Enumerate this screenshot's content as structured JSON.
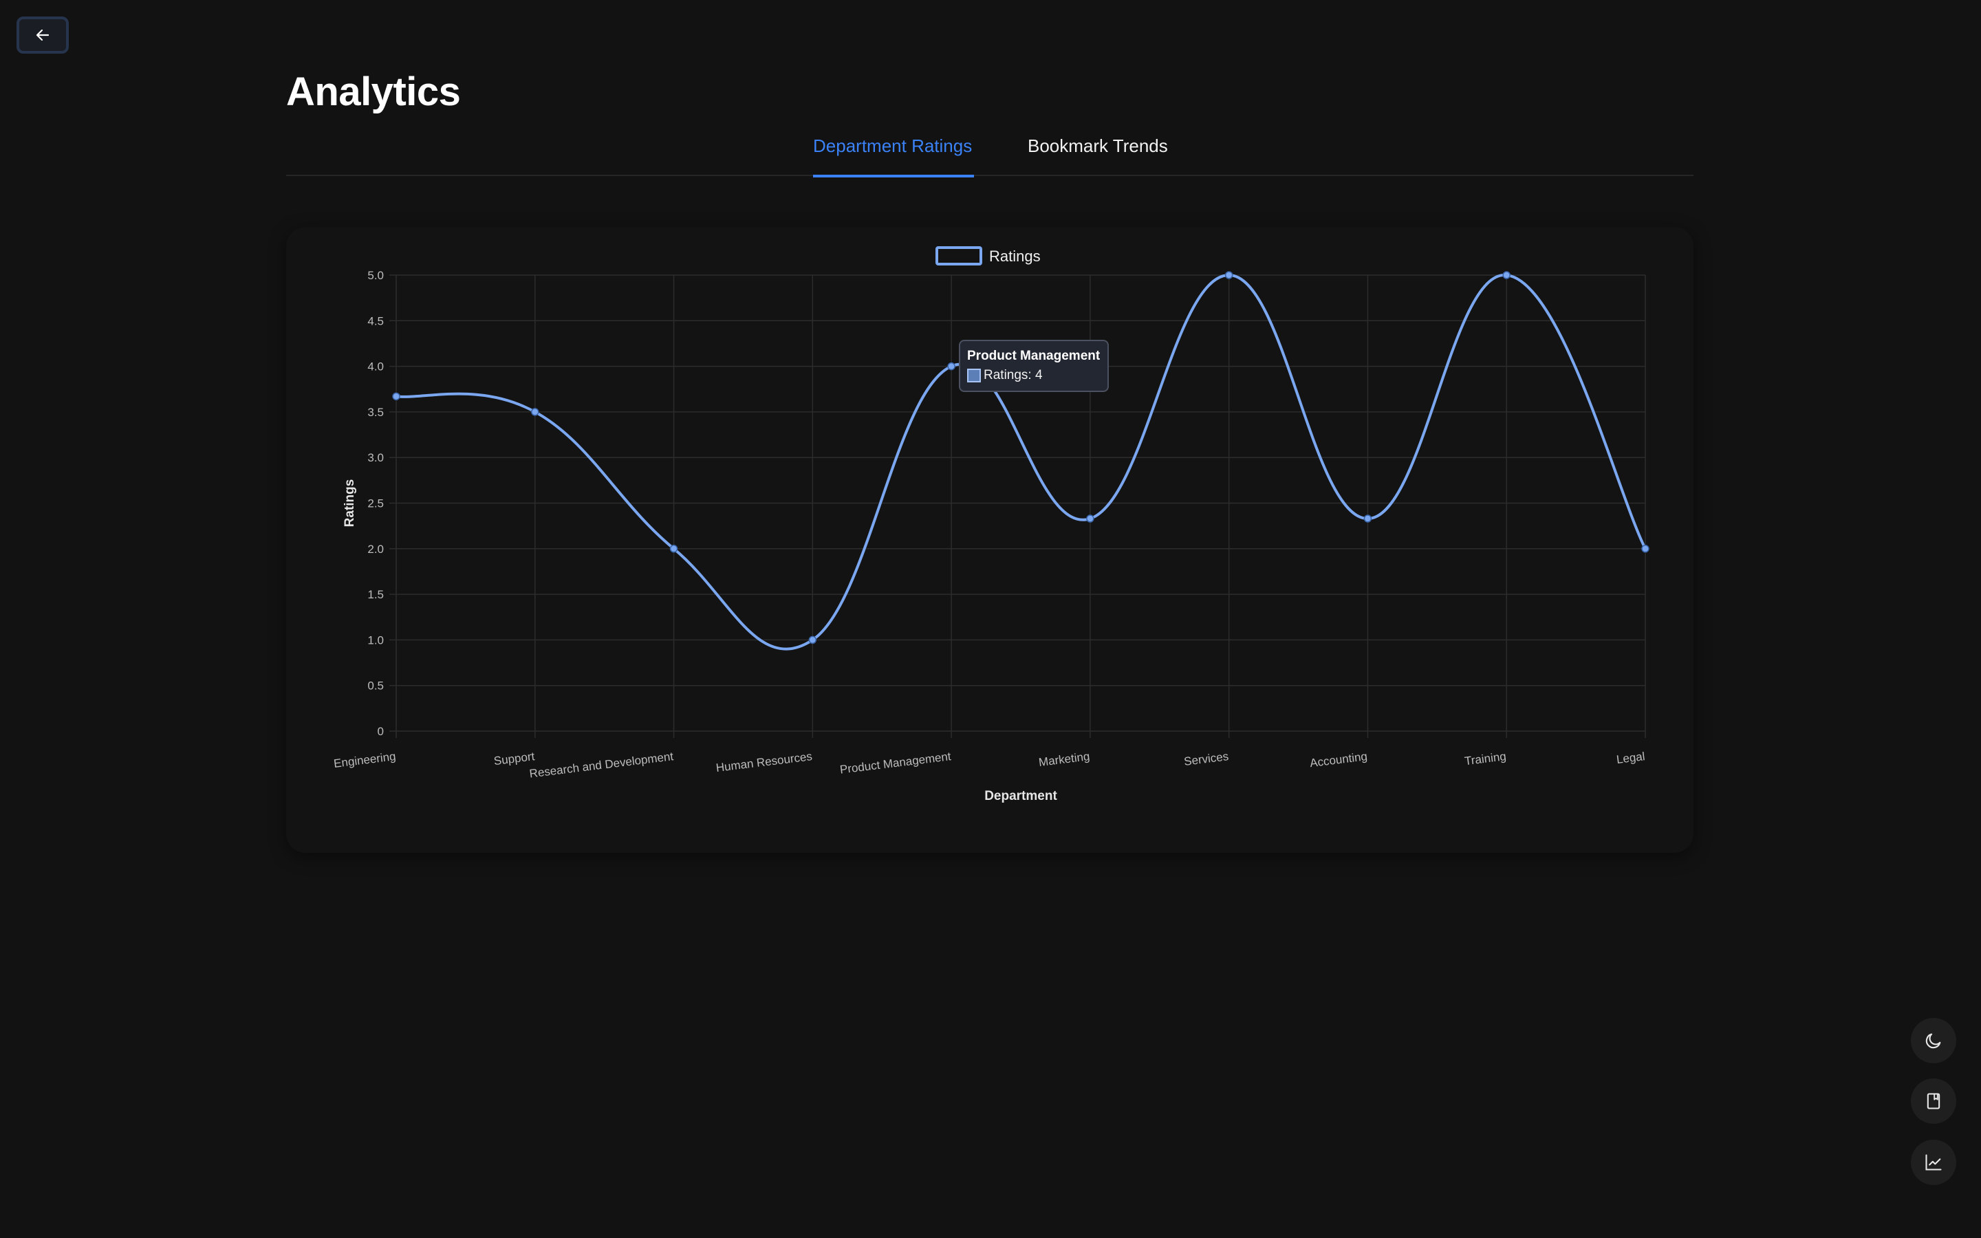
{
  "page": {
    "title": "Analytics",
    "back_icon": "arrow-left-icon"
  },
  "tabs": [
    {
      "label": "Department Ratings",
      "active": true
    },
    {
      "label": "Bookmark Trends",
      "active": false
    }
  ],
  "tooltip": {
    "title": "Product Management",
    "line": "Ratings: 4"
  },
  "side_buttons": [
    {
      "icon": "moon-icon"
    },
    {
      "icon": "bookmark-icon"
    },
    {
      "icon": "line-chart-icon"
    }
  ],
  "colors": {
    "accent": "#3b82f6",
    "line": "#7aa7f0",
    "background": "#121212"
  },
  "chart_data": {
    "type": "line",
    "categories": [
      "Engineering",
      "Support",
      "Research and Development",
      "Human Resources",
      "Product Management",
      "Marketing",
      "Services",
      "Accounting",
      "Training",
      "Legal"
    ],
    "series": [
      {
        "name": "Ratings",
        "values": [
          3.67,
          3.5,
          2.0,
          1.0,
          4.0,
          2.33,
          5.0,
          2.33,
          5.0,
          2.0
        ]
      }
    ],
    "xlabel": "Department",
    "ylabel": "Ratings",
    "ylim": [
      0,
      5
    ],
    "yticks": [
      "0",
      "0.5",
      "1.0",
      "1.5",
      "2.0",
      "2.5",
      "3.0",
      "3.5",
      "4.0",
      "4.5",
      "5.0"
    ],
    "legend_position": "top-center",
    "grid": true
  }
}
